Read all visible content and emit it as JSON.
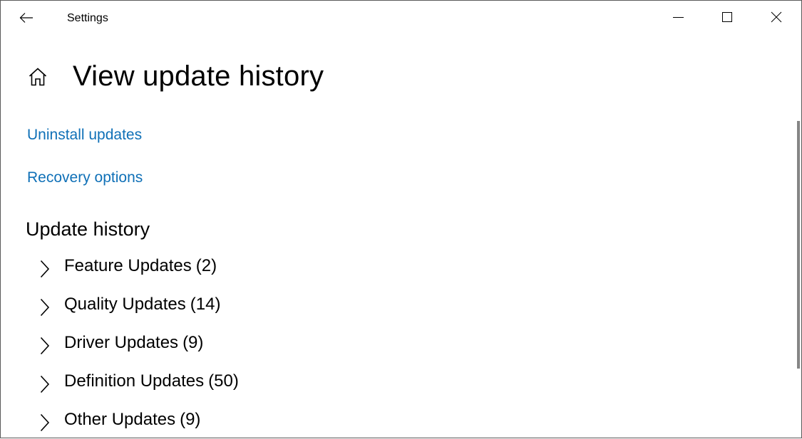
{
  "window": {
    "title": "Settings",
    "controls": {
      "minimize": "minimize-icon",
      "maximize": "maximize-icon",
      "close": "close-icon"
    }
  },
  "nav": {
    "back_icon": "back-arrow-icon",
    "home_icon": "home-icon"
  },
  "page": {
    "title": "View update history",
    "links": [
      {
        "label": "Uninstall updates"
      },
      {
        "label": "Recovery options"
      }
    ],
    "accent_color": "#0f70b7",
    "section_title": "Update history",
    "groups": [
      {
        "label": "Feature Updates",
        "count": "(2)"
      },
      {
        "label": "Quality Updates",
        "count": "(14)"
      },
      {
        "label": "Driver Updates",
        "count": "(9)"
      },
      {
        "label": "Definition Updates",
        "count": "(50)"
      },
      {
        "label": "Other Updates",
        "count": "(9)"
      }
    ]
  }
}
